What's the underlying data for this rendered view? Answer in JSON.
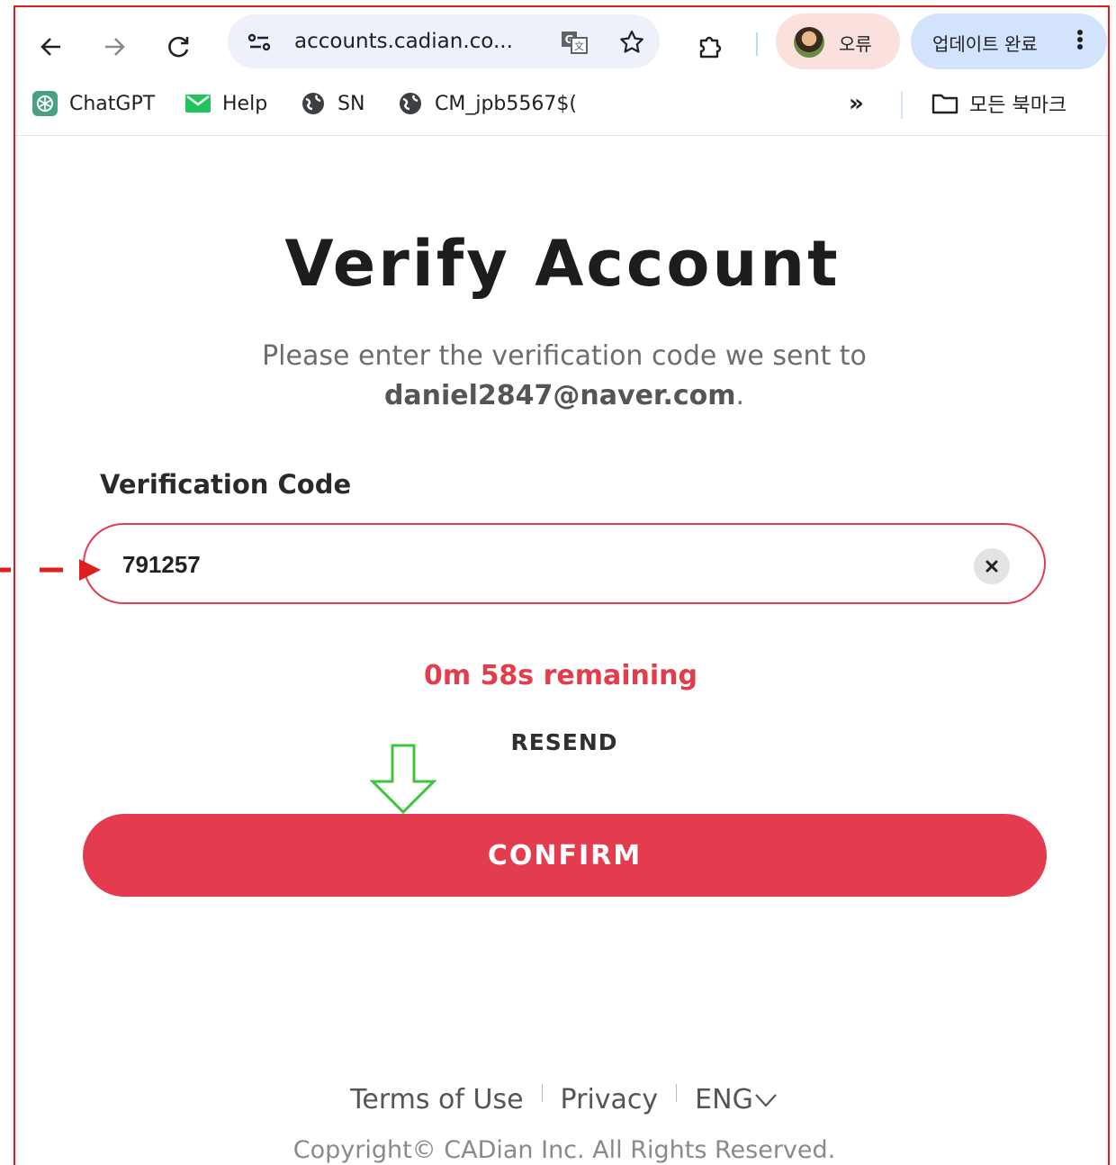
{
  "browser": {
    "url": "accounts.cadian.co...",
    "profile_label": "오류",
    "update_label": "업데이트 완료",
    "bookmarks": [
      {
        "label": "ChatGPT",
        "icon": "chatgpt-icon"
      },
      {
        "label": "Help",
        "icon": "mail-icon"
      },
      {
        "label": "SN",
        "icon": "globe-icon"
      },
      {
        "label": "CM_jpb5567$(",
        "icon": "globe-icon"
      }
    ],
    "more_bookmarks_label": "»",
    "all_bookmarks_label": "모든 북마크"
  },
  "page": {
    "title": "Verify Account",
    "subtitle": "Please enter the verification code we sent to",
    "email": "daniel2847@naver.com",
    "email_suffix": ".",
    "field_label": "Verification Code",
    "code_value": "791257",
    "timer": "0m 58s remaining",
    "resend_label": "RESEND",
    "confirm_label": "CONFIRM"
  },
  "footer": {
    "terms_label": "Terms of Use",
    "privacy_label": "Privacy",
    "language_label": "ENG",
    "copyright": "Copyright© CADian Inc. All Rights Reserved."
  },
  "colors": {
    "accent": "#e43c4f",
    "annotation_red": "#e01e1e",
    "annotation_green": "#3cc43c"
  }
}
